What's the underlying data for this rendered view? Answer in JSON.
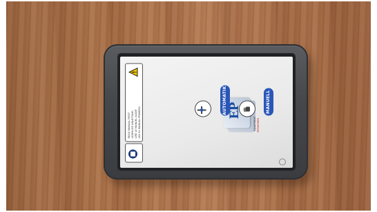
{
  "scene": {
    "surface": "wooden table",
    "device_bezel_color": "#46484c",
    "screen_color": "#eaeaea"
  },
  "ui": {
    "warning": {
      "lines": [
        "READ MANUAL FIRST",
        "LESEN SIE ANLEITUNG",
        "LIRE LE MANUEL AVANT",
        "LEA EL MANUAL PRIMERO"
      ]
    },
    "logo": {
      "letters": "EP",
      "brand": "EQUIPMENT",
      "tagline": "EPOWERED"
    },
    "buttons": {
      "automatic_label": "AUTOMATIK",
      "manual_label": "MANUELL"
    },
    "accent_color": "#2a56b8"
  }
}
